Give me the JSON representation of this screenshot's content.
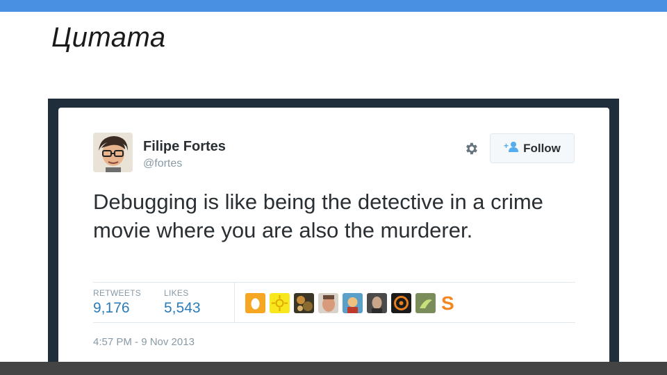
{
  "slide": {
    "title": "Цитата"
  },
  "tweet": {
    "author_name": "Filipe Fortes",
    "author_handle": "@fortes",
    "follow_label": "Follow",
    "text": "Debugging is like being the detective in a crime movie where you are also the murderer.",
    "stats": {
      "retweets_label": "RETWEETS",
      "retweets_value": "9,176",
      "likes_label": "LIKES",
      "likes_value": "5,543"
    },
    "liker_avatars": [
      "egg-avatar",
      "sun-avatar",
      "food-avatar",
      "face-avatar",
      "cartoon-avatar",
      "portrait-avatar",
      "target-avatar",
      "plant-avatar",
      "s-letter-avatar"
    ],
    "timestamp": "4:57 PM - 9 Nov 2013"
  },
  "colors": {
    "accent_top_bar": "#4a90e2",
    "frame": "#1f2e3a",
    "link_blue": "#2b7bb9",
    "muted_text": "#8899a6",
    "body_text": "#292f33"
  }
}
